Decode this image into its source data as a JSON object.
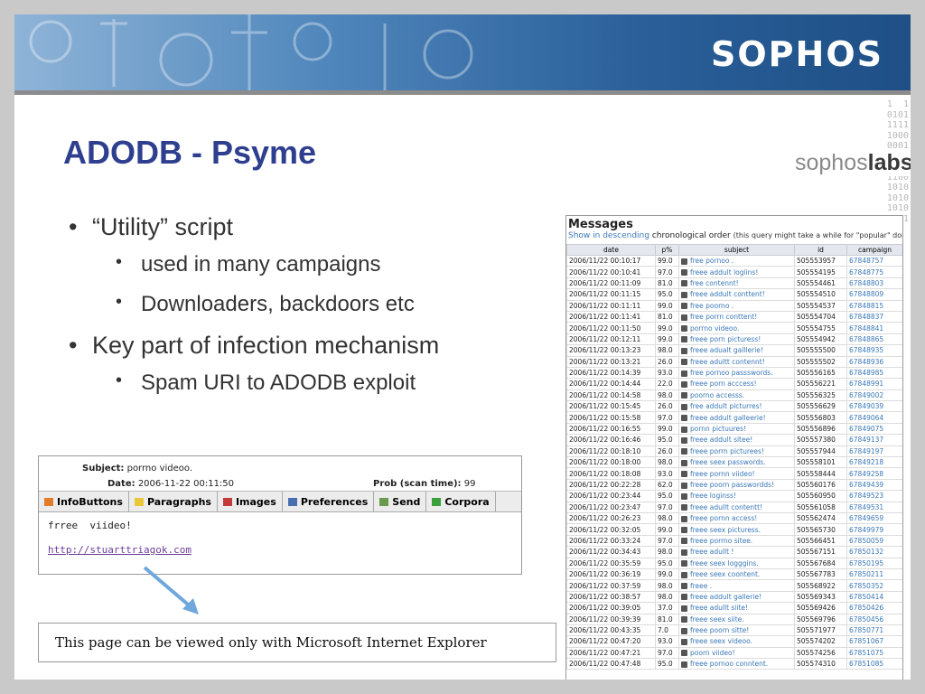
{
  "brand": {
    "logo": "SOPHOS",
    "labs_a": "sophos",
    "labs_b": "labs"
  },
  "binary": "1  1\n0101\n1111\n1000\n0001\n1 01\n1001\n1100\n1010\n1010\n1010\n1 1",
  "title": "ADODB - Psyme",
  "bullets": {
    "b1": "“Utility” script",
    "b1a": "used in many campaigns",
    "b1b": "Downloaders, backdoors etc",
    "b2": "Key part of infection mechanism",
    "b2a": "Spam URI to ADODB exploit"
  },
  "messages": {
    "title": "Messages",
    "sub_link": "Show in descending",
    "sub_text": " chronological order ",
    "sub_note": "(this query might take a while for \"popular\" domain",
    "headers": [
      "date",
      "p%",
      "subject",
      "id",
      "campaign"
    ],
    "rows": [
      [
        "2006/11/22 00:10:17",
        "99.0",
        "free pornoo .",
        "505553957",
        "67848757"
      ],
      [
        "2006/11/22 00:10:41",
        "97.0",
        "freee addult logiins!",
        "505554195",
        "67848775"
      ],
      [
        "2006/11/22 00:11:09",
        "81.0",
        "free contennt!",
        "505554461",
        "67848803"
      ],
      [
        "2006/11/22 00:11:15",
        "95.0",
        "freee addult conttent!",
        "505554510",
        "67848809"
      ],
      [
        "2006/11/22 00:11:11",
        "99.0",
        "free poorno .",
        "505554537",
        "67848815"
      ],
      [
        "2006/11/22 00:11:41",
        "81.0",
        "free porrn conttent!",
        "505554704",
        "67848837"
      ],
      [
        "2006/11/22 00:11:50",
        "99.0",
        "porrno videoo.",
        "505554755",
        "67848841"
      ],
      [
        "2006/11/22 00:12:11",
        "99.0",
        "freee porn picturess!",
        "505554942",
        "67848865"
      ],
      [
        "2006/11/22 00:13:23",
        "98.0",
        "freee adualt galllerie!",
        "505555500",
        "67848935"
      ],
      [
        "2006/11/22 00:13:21",
        "26.0",
        "freee adultt contennt!",
        "505555502",
        "67848936"
      ],
      [
        "2006/11/22 00:14:39",
        "93.0",
        "free pornoo passswords.",
        "505556165",
        "67848985"
      ],
      [
        "2006/11/22 00:14:44",
        "22.0",
        "freee porn acccess!",
        "505556221",
        "67848991"
      ],
      [
        "2006/11/22 00:14:58",
        "98.0",
        "poorno accesss.",
        "505556325",
        "67849002"
      ],
      [
        "2006/11/22 00:15:45",
        "26.0",
        "free addult picturres!",
        "505556629",
        "67849039"
      ],
      [
        "2006/11/22 00:15:58",
        "97.0",
        "freee addult galleerie!",
        "505556803",
        "67849064"
      ],
      [
        "2006/11/22 00:16:55",
        "99.0",
        "pornn pictuures!",
        "505556896",
        "67849075"
      ],
      [
        "2006/11/22 00:16:46",
        "95.0",
        "freee addult sitee!",
        "505557380",
        "67849137"
      ],
      [
        "2006/11/22 00:18:10",
        "26.0",
        "freee porrn picturees!",
        "505557944",
        "67849197"
      ],
      [
        "2006/11/22 00:18:00",
        "98.0",
        "freee seex passwords.",
        "505558101",
        "67849218"
      ],
      [
        "2006/11/22 00:18:08",
        "93.0",
        "freee pornn viideo!",
        "505558444",
        "67849258"
      ],
      [
        "2006/11/22 00:22:28",
        "62.0",
        "freee poorn passwordds!",
        "505560176",
        "67849439"
      ],
      [
        "2006/11/22 00:23:44",
        "95.0",
        "freee loginss!",
        "505560950",
        "67849523"
      ],
      [
        "2006/11/22 00:23:47",
        "97.0",
        "freee adullt contentt!",
        "505561058",
        "67849531"
      ],
      [
        "2006/11/22 00:26:23",
        "98.0",
        "freee pornn access!",
        "505562474",
        "67849659"
      ],
      [
        "2006/11/22 00:32:05",
        "99.0",
        "freee seex picturess.",
        "505565730",
        "67849979"
      ],
      [
        "2006/11/22 00:33:24",
        "97.0",
        "freee porrno sitee.",
        "505566451",
        "67850059"
      ],
      [
        "2006/11/22 00:34:43",
        "98.0",
        "freee adullt !",
        "505567151",
        "67850132"
      ],
      [
        "2006/11/22 00:35:59",
        "95.0",
        "freee seex logggins.",
        "505567684",
        "67850195"
      ],
      [
        "2006/11/22 00:36:19",
        "99.0",
        "freee seex coontent.",
        "505567783",
        "67850211"
      ],
      [
        "2006/11/22 00:37:59",
        "98.0",
        "freee .",
        "505568922",
        "67850352"
      ],
      [
        "2006/11/22 00:38:57",
        "98.0",
        "freee addult gallerie!",
        "505569343",
        "67850414"
      ],
      [
        "2006/11/22 00:39:05",
        "37.0",
        "freee adullt siite!",
        "505569426",
        "67850426"
      ],
      [
        "2006/11/22 00:39:39",
        "81.0",
        "freee seex siite.",
        "505569796",
        "67850456"
      ],
      [
        "2006/11/22 00:43:35",
        "7.0",
        "freee poorn sitte!",
        "505571977",
        "67850771"
      ],
      [
        "2006/11/22 00:47:20",
        "93.0",
        "freee seex videoo.",
        "505574202",
        "67851067"
      ],
      [
        "2006/11/22 00:47:21",
        "97.0",
        "poorn viideo!",
        "505574256",
        "67851075"
      ],
      [
        "2006/11/22 00:47:48",
        "95.0",
        "freee pornoo conntent.",
        "505574310",
        "67851085"
      ]
    ]
  },
  "mail": {
    "subject_label": "Subject:",
    "subject": "porrno videoo.",
    "date_label": "Date:",
    "date": "2006-11-22 00:11:50",
    "prob_label": "Prob (scan time):",
    "prob": "99",
    "tabs": [
      {
        "label": "InfoButtons",
        "icon": "info-icon",
        "color": "#e07b2a"
      },
      {
        "label": "Paragraphs",
        "icon": "note-icon",
        "color": "#e8c83a"
      },
      {
        "label": "Images",
        "icon": "image-icon",
        "color": "#c43a3a"
      },
      {
        "label": "Preferences",
        "icon": "preferences-icon",
        "color": "#4a6fb0"
      },
      {
        "label": "Send",
        "icon": "send-icon",
        "color": "#6a9a4a"
      },
      {
        "label": "Corpora",
        "icon": "corpora-icon",
        "color": "#3aa03a"
      }
    ],
    "body_text": "frree  viideo!",
    "link": "http://stuarttriagok.com"
  },
  "ie_message": "This page can be viewed only with Microsoft Internet Explorer"
}
